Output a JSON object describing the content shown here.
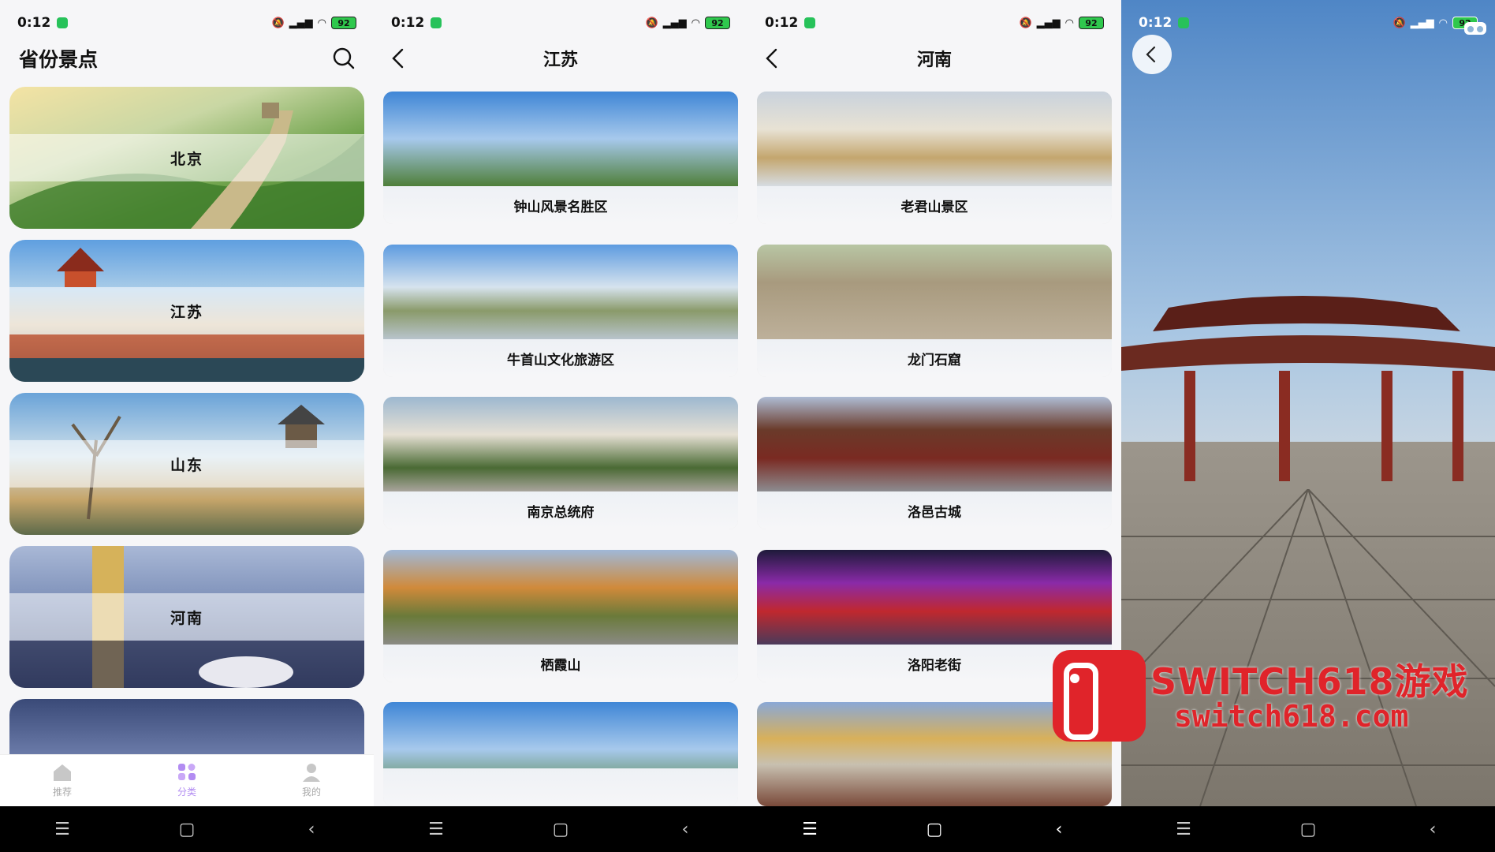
{
  "status_bar": {
    "time": "0:12",
    "battery": "92"
  },
  "screen_provinces": {
    "title": "省份景点",
    "cards": [
      "北京",
      "江苏",
      "山东",
      "河南",
      ""
    ],
    "tabs": [
      {
        "label": "推荐",
        "icon": "home-icon"
      },
      {
        "label": "分类",
        "icon": "category-icon"
      },
      {
        "label": "我的",
        "icon": "user-icon"
      }
    ],
    "active_tab": "分类"
  },
  "screen_jiangsu": {
    "title": "江苏",
    "spots": [
      "钟山风景名胜区",
      "牛首山文化旅游区",
      "南京总统府",
      "栖霞山",
      ""
    ]
  },
  "screen_henan": {
    "title": "河南",
    "spots": [
      "老君山景区",
      "龙门石窟",
      "洛邑古城",
      "洛阳老街",
      ""
    ]
  },
  "watermark": {
    "title": "SWITCH618游戏",
    "url": "switch618.com"
  },
  "colors": {
    "accent": "#b28cf2",
    "watermark": "#e0242a"
  }
}
